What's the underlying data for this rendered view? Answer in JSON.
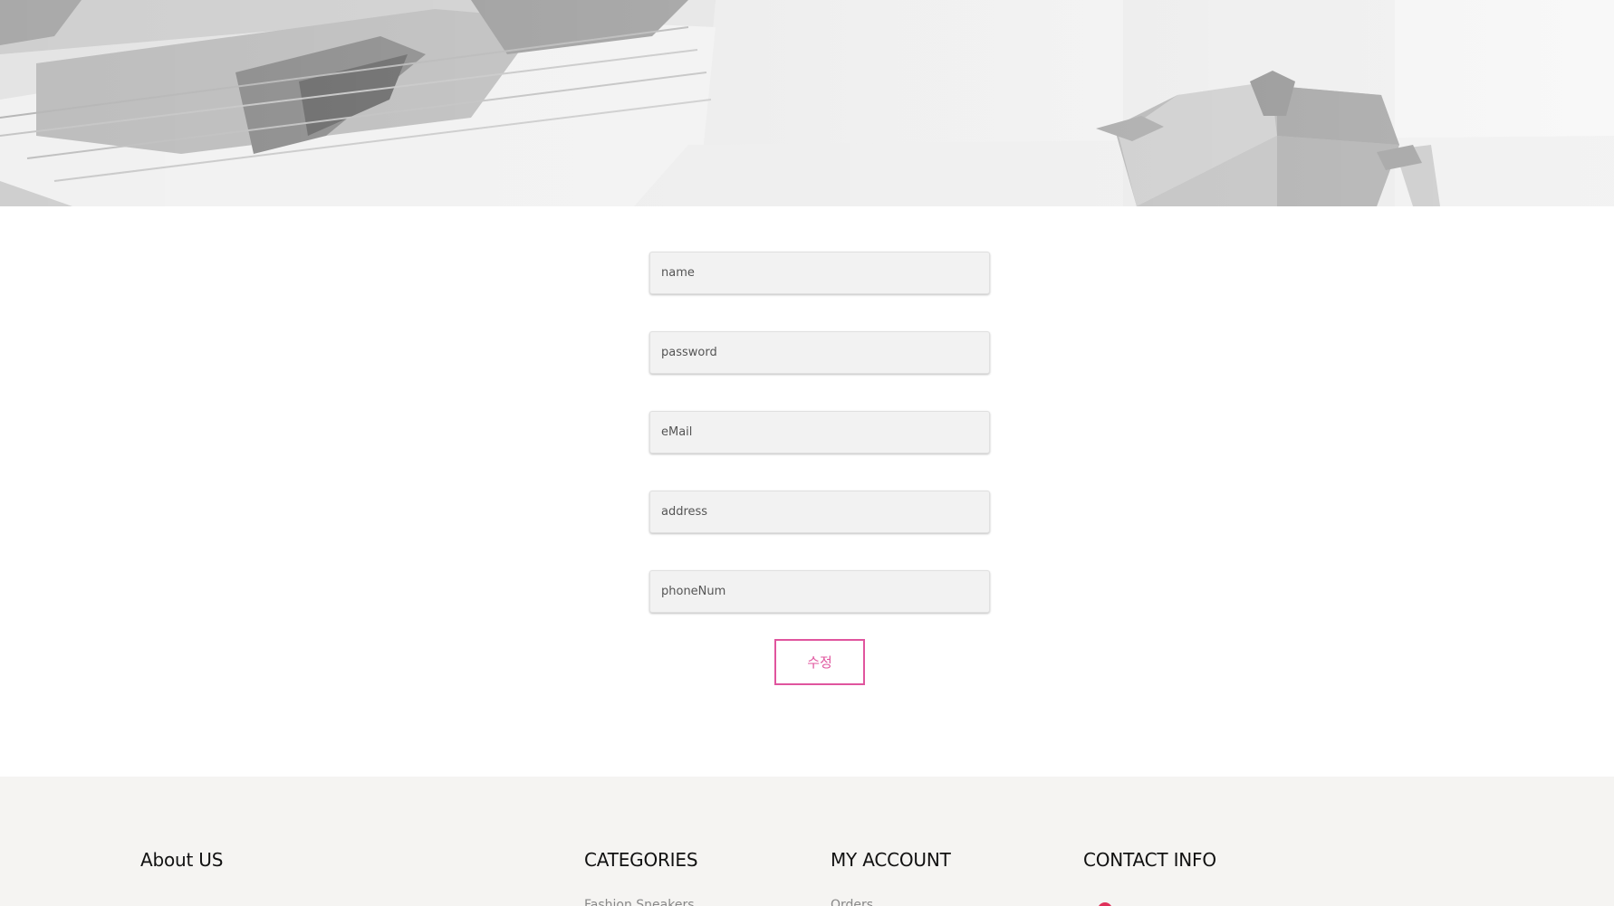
{
  "form": {
    "fields": [
      {
        "placeholder": "name"
      },
      {
        "placeholder": "password"
      },
      {
        "placeholder": "eMail"
      },
      {
        "placeholder": "address"
      },
      {
        "placeholder": "phoneNum"
      }
    ],
    "submit_label": "수정"
  },
  "footer": {
    "about_title": "About US",
    "categories_title": "CATEGORIES",
    "categories_first_item": "Fashion Sneakers",
    "account_title": "MY ACCOUNT",
    "account_first_item": "Orders",
    "contact_title": "CONTACT INFO"
  },
  "colors": {
    "accent": "#e0559e",
    "footer_bg": "#f5f4f2",
    "field_bg": "#f2f2f2"
  }
}
